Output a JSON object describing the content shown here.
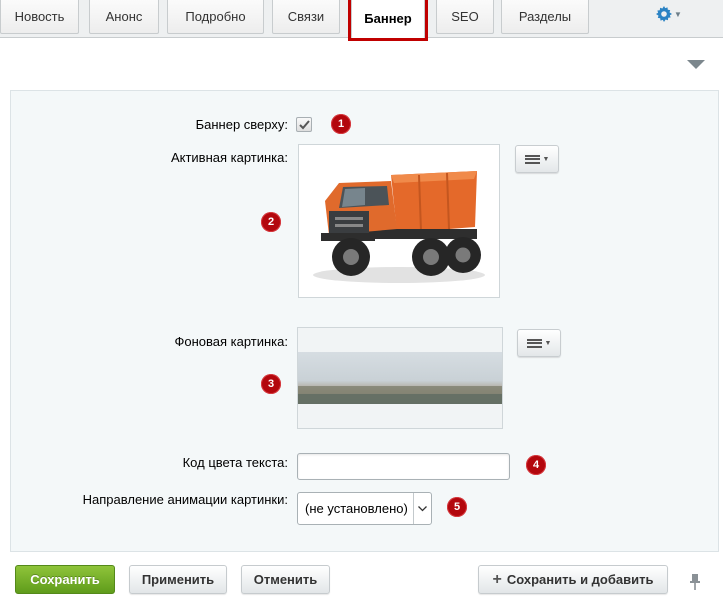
{
  "tabs": [
    {
      "label": "Новость"
    },
    {
      "label": "Анонс"
    },
    {
      "label": "Подробно"
    },
    {
      "label": "Связи"
    },
    {
      "label": "Баннер",
      "active": true
    },
    {
      "label": "SEO"
    },
    {
      "label": "Разделы"
    }
  ],
  "form": {
    "banner_top_label": "Баннер сверху:",
    "banner_top_checked": true,
    "active_image_label": "Активная картинка:",
    "background_image_label": "Фоновая картинка:",
    "text_color_label": "Код цвета текста:",
    "text_color_value": "",
    "animation_label": "Направление анимации картинки:",
    "animation_value": "(не установлено)"
  },
  "badges": [
    "1",
    "2",
    "3",
    "4",
    "5"
  ],
  "buttons": {
    "save": "Сохранить",
    "apply": "Применить",
    "cancel": "Отменить",
    "save_add": "Сохранить и добавить"
  },
  "icons": {
    "settings": "gear-icon",
    "collapse": "triangle-down-icon",
    "menu": "hamburger-menu-icon",
    "pin": "pin-icon"
  },
  "colors": {
    "highlight": "#c00000",
    "badge": "#b3070d",
    "save_button": "#6fa925",
    "truck_cab": "#e06a2c",
    "gear": "#2b83c4"
  }
}
